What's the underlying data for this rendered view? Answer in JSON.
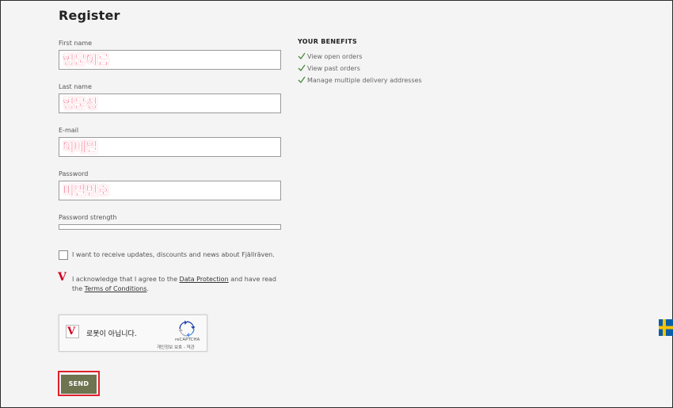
{
  "form": {
    "title": "Register",
    "first_name": {
      "label": "First name",
      "value": "영문이름"
    },
    "last_name": {
      "label": "Last name",
      "value": "영문성"
    },
    "email": {
      "label": "E-mail",
      "value": "이메일"
    },
    "password": {
      "label": "Password",
      "value": "비밀번호"
    },
    "password_strength_label": "Password strength",
    "password_strength_fraction": 0,
    "newsletter": {
      "text": "I want to receive updates, discounts and news about Fjällräven.",
      "checked": false
    },
    "consent": {
      "mark": "V",
      "text_1": "I acknowledge that I agree to the ",
      "link_1": "Data Protection",
      "text_2": " and have read",
      "text_3": "the ",
      "link_2": "Terms of Conditions",
      "text_4": "."
    },
    "send_label": "SEND"
  },
  "benefits": {
    "title": "YOUR BENEFITS",
    "items": [
      "View open orders",
      "View past orders",
      "Manage multiple delivery addresses"
    ],
    "check_color": "#4a8a3c"
  },
  "recaptcha": {
    "mark": "V",
    "label": "로봇이 아닙니다.",
    "brand": "reCAPTCHA",
    "terms": "개인정보 보호 - 약관"
  },
  "colors": {
    "annotation_red": "#e8002d",
    "send_button": "#6e7350",
    "flag_blue": "#0a5ea8",
    "flag_yellow": "#f6c300"
  },
  "icons": {
    "checkmark": "checkmark-icon",
    "recaptcha": "recaptcha-logo-icon",
    "flag": "swedish-flag-icon"
  }
}
